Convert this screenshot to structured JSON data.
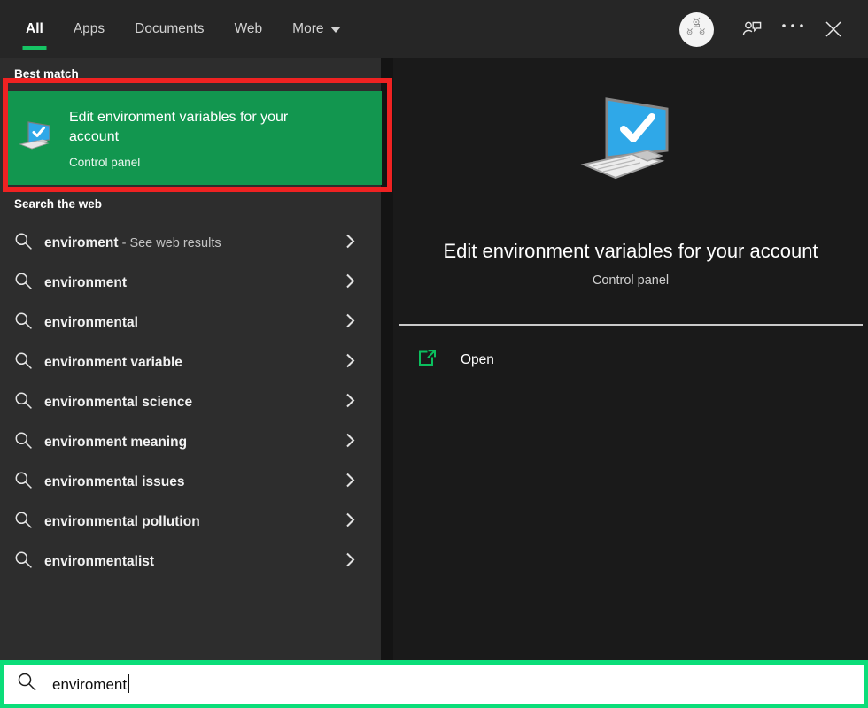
{
  "header": {
    "tabs": [
      {
        "label": "All",
        "active": true
      },
      {
        "label": "Apps",
        "active": false
      },
      {
        "label": "Documents",
        "active": false
      },
      {
        "label": "Web",
        "active": false
      },
      {
        "label": "More",
        "active": false,
        "has_caret": true
      }
    ],
    "accent_color": "#16c464",
    "icons": {
      "avatar": "user-avatar",
      "feedback": "feedback-person-icon",
      "more_options": "ellipsis-icon",
      "close": "close-icon"
    }
  },
  "left": {
    "best_match_label": "Best match",
    "best_match": {
      "title": "Edit environment variables for your account",
      "subtitle": "Control panel",
      "icon": "monitor-check-icon",
      "highlight_color": "#12964f"
    },
    "web_label": "Search the web",
    "web_results": [
      {
        "query": "enviroment",
        "suffix": " - See web results"
      },
      {
        "query": "environment",
        "suffix": ""
      },
      {
        "query": "environmental",
        "suffix": ""
      },
      {
        "query": "environment variable",
        "suffix": ""
      },
      {
        "query": "environmental science",
        "suffix": ""
      },
      {
        "query": "environment meaning",
        "suffix": ""
      },
      {
        "query": "environmental issues",
        "suffix": ""
      },
      {
        "query": "environmental pollution",
        "suffix": ""
      },
      {
        "query": "environmentalist",
        "suffix": ""
      }
    ]
  },
  "right": {
    "title": "Edit environment variables for your account",
    "subtitle": "Control panel",
    "icon": "monitor-check-large-icon",
    "actions": [
      {
        "label": "Open",
        "icon": "open-external-icon",
        "color": "#0bbf5e"
      }
    ]
  },
  "search": {
    "value": "enviroment",
    "placeholder": "Type here to search",
    "icon": "search-icon",
    "highlight_color": "#0bdd79"
  },
  "annotations": {
    "best_match_box_color": "#ef2222",
    "search_box_color": "#0bdd79"
  }
}
